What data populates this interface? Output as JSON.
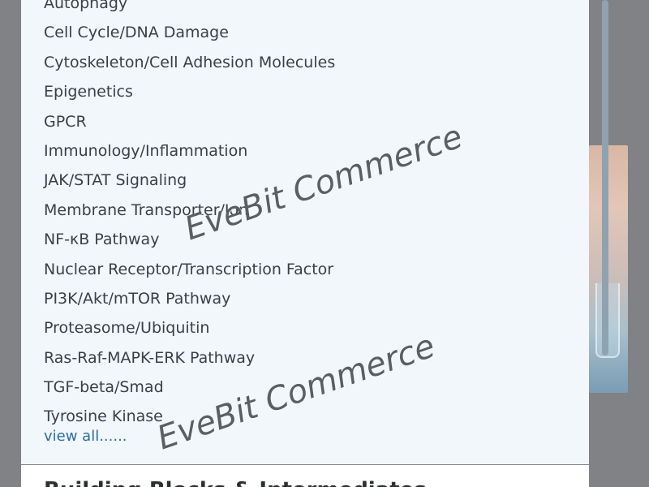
{
  "categories": [
    "Autophagy",
    "Cell Cycle/DNA Damage",
    "Cytoskeleton/Cell Adhesion Molecules",
    "Epigenetics",
    "GPCR",
    "Immunology/Inflammation",
    "JAK/STAT Signaling",
    "Membrane Transporter/Ion",
    "NF-κB Pathway",
    "Nuclear Receptor/Transcription Factor",
    "PI3K/Akt/mTOR Pathway",
    "Proteasome/Ubiquitin",
    "Ras-Raf-MAPK-ERK Pathway",
    "TGF-beta/Smad",
    "Tyrosine Kinase"
  ],
  "view_all_label": "view all......",
  "footer_heading": "Building Blocks & Intermediates",
  "watermark": "EveBit Commerce",
  "colors": {
    "panel_bg": "#f1f7fb",
    "link": "#2c6e9b",
    "text": "#3c4046"
  }
}
